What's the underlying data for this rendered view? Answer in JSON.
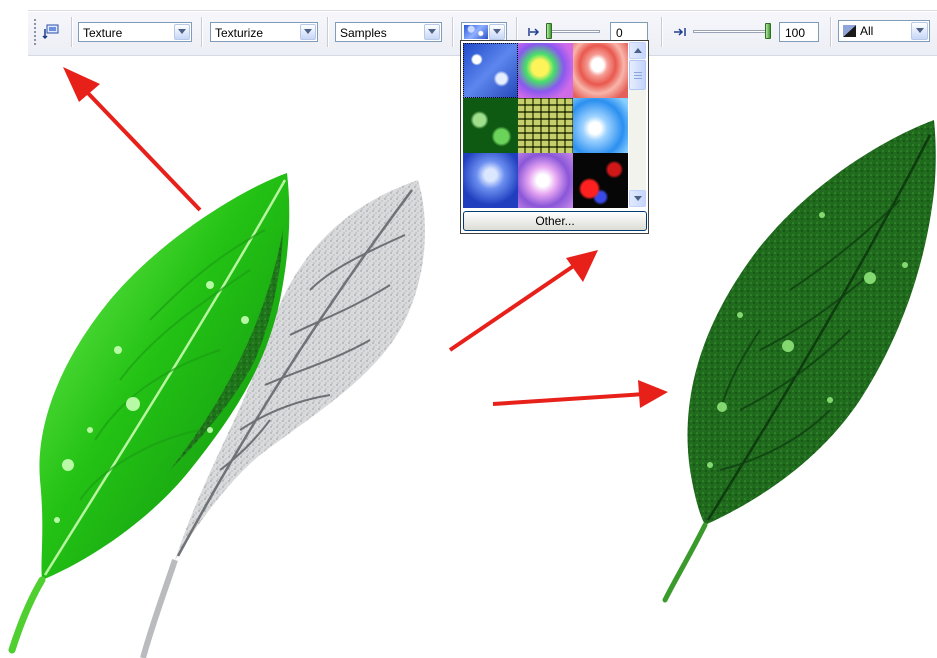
{
  "toolbar": {
    "fill_type": "Texture",
    "texture_type": "Texturize",
    "library": "Samples",
    "start_value": "0",
    "end_value": "100",
    "apply_to": "All"
  },
  "texture_picker": {
    "other_label": "Other..."
  },
  "colors": {
    "arrow": "#e8201a",
    "leaf_bright": "#3fd02a",
    "leaf_dark": "#1d5a1a",
    "combo_border": "#7f9db9"
  }
}
